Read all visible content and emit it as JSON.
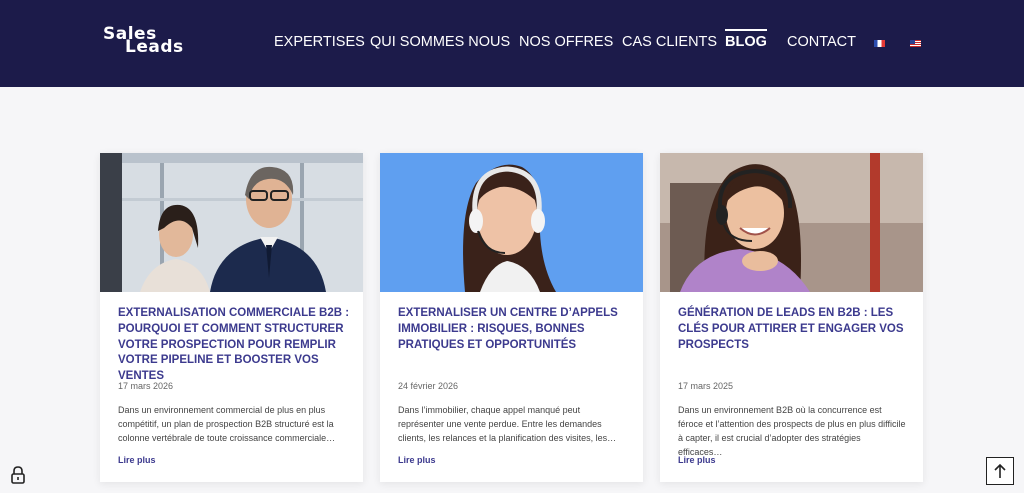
{
  "logo": {
    "line1": "Sales",
    "line2": "Leads"
  },
  "nav": {
    "items": [
      {
        "label": "EXPERTISES"
      },
      {
        "label": "QUI SOMMES NOUS"
      },
      {
        "label": "NOS OFFRES"
      },
      {
        "label": "CAS CLIENTS"
      },
      {
        "label": "BLOG"
      },
      {
        "label": "CONTACT"
      }
    ],
    "active": "BLOG",
    "flags": [
      "flag-fr-icon",
      "flag-us-icon"
    ]
  },
  "colors": {
    "header_bg": "#1c1b4a",
    "accent": "#3c3a8e",
    "page_bg": "#f6f6f8"
  },
  "posts": [
    {
      "title": "EXTERNALISATION COMMERCIALE B2B : POURQUOI ET COMMENT STRUCTURER VOTRE PROSPECTION POUR REMPLIR VOTRE PIPELINE ET BOOSTER VOS VENTES",
      "date": "17 mars 2026",
      "excerpt": "Dans un environnement commercial de plus en plus compétitif, un plan de prospection B2B structuré est la colonne vertébrale de toute croissance commerciale…",
      "more": "Lire plus"
    },
    {
      "title": "EXTERNALISER UN CENTRE D’APPELS IMMOBILIER : RISQUES, BONNES PRATIQUES ET OPPORTUNITÉS",
      "date": "24 février 2026",
      "excerpt": "Dans l’immobilier, chaque appel manqué peut représenter une vente perdue. Entre les demandes clients, les relances et la planification des visites, les…",
      "more": "Lire plus"
    },
    {
      "title": "GÉNÉRATION DE LEADS EN B2B : LES CLÉS POUR ATTIRER ET ENGAGER VOS PROSPECTS",
      "date": "17 mars 2025",
      "excerpt": "Dans un environnement B2B où la concurrence est féroce et l’attention des prospects de plus en plus difficile à capter, il est crucial d’adopter des stratégies efficaces…",
      "more": "Lire plus"
    }
  ]
}
